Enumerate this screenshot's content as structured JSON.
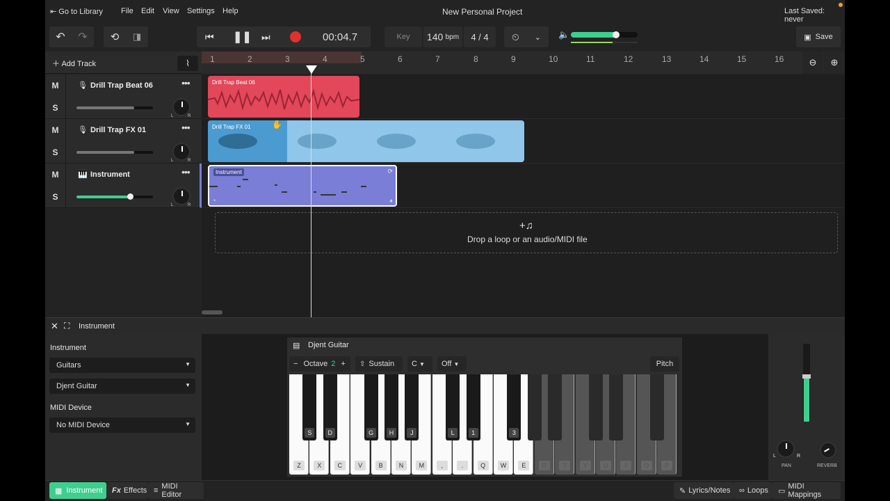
{
  "menu": {
    "go_to_library": "Go to Library",
    "items": [
      "File",
      "Edit",
      "View",
      "Settings",
      "Help"
    ],
    "project_title": "New Personal Project",
    "last_saved": "Last Saved: never"
  },
  "toolbar": {
    "time": "00:04.7",
    "key_label": "Key",
    "tempo": "140",
    "bpm_unit": "bpm",
    "time_signature": "4 / 4",
    "volume_fraction": 0.75,
    "save_label": "Save"
  },
  "tracks_header": {
    "add_track": "Add Track"
  },
  "tracks": [
    {
      "name": "Drill Trap Beat 06",
      "mute": "M",
      "solo": "S",
      "volume_fraction": 0.75,
      "pan_l": "L",
      "pan_r": "R"
    },
    {
      "name": "Drill Trap FX 01",
      "mute": "M",
      "solo": "S",
      "volume_fraction": 0.75,
      "pan_l": "L",
      "pan_r": "R"
    },
    {
      "name": "Instrument",
      "mute": "M",
      "solo": "S",
      "volume_fraction": 0.7,
      "pan_l": "L",
      "pan_r": "R"
    }
  ],
  "ruler": [
    "1",
    "2",
    "3",
    "4",
    "5",
    "6",
    "7",
    "8",
    "9",
    "10",
    "11",
    "12",
    "13",
    "14",
    "15",
    "16"
  ],
  "clips": {
    "beat": "Drill Trap Beat 06",
    "fx": "Drill Trap FX 01",
    "instrument": "Instrument"
  },
  "drop_zone": {
    "text": "Drop a loop or an audio/MIDI file"
  },
  "colors": {
    "accent": "#3ecf8e",
    "beat_clip": "#e2475a",
    "fx_clip": "#7dbde6",
    "instrument_clip": "#7a7ed6"
  },
  "panel": {
    "title": "Instrument"
  },
  "side_panel": {
    "instrument_label": "Instrument",
    "category": "Guitars",
    "preset": "Djent Guitar",
    "midi_label": "MIDI Device",
    "midi_device": "No MIDI Device"
  },
  "piano": {
    "title": "Djent Guitar",
    "octave_label": "Octave",
    "octave_value": "2",
    "minus": "−",
    "plus": "+",
    "sustain": "Sustain",
    "key": "C",
    "scale": "Off",
    "pitch": "Pitch",
    "white_labels": [
      "Z",
      "X",
      "C",
      "V",
      "B",
      "N",
      "M",
      ",",
      ".",
      "Q",
      "W",
      "E",
      "R",
      "T",
      "Y",
      "U",
      "I",
      "O",
      "P"
    ],
    "black_labels": [
      "S",
      "D",
      "G",
      "H",
      "J",
      "L",
      "1",
      "3",
      "4",
      "5",
      "7",
      "8",
      "0"
    ]
  },
  "mixer": {
    "pan_label": "PAN",
    "reverb_label": "REVERB",
    "l": "L",
    "r": "R"
  },
  "bottom_tabs": {
    "instrument": "Instrument",
    "effects": "Effects",
    "midi_editor": "MIDI Editor",
    "lyrics": "Lyrics/Notes",
    "loops": "Loops",
    "midi_mappings": "MIDI Mappings"
  }
}
